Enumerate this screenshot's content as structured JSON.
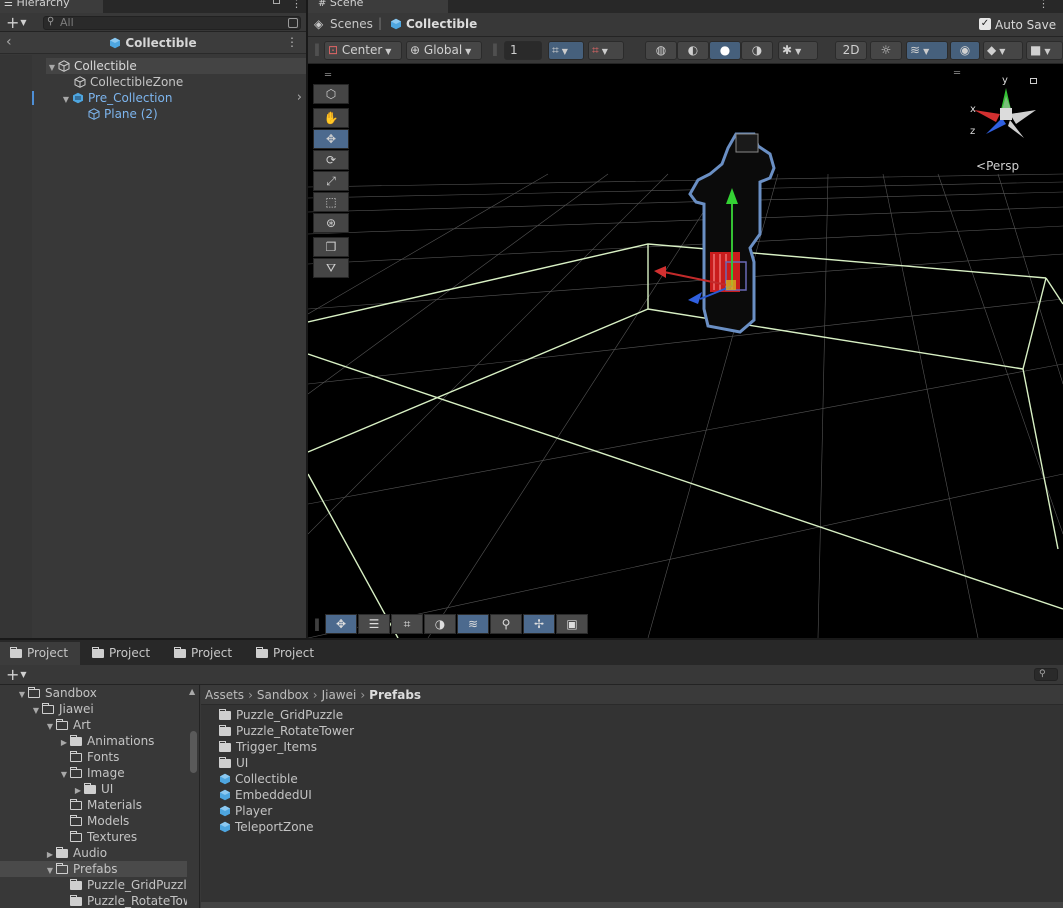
{
  "hierarchy": {
    "tab_title": "Hierarchy",
    "search_placeholder": "All",
    "breadcrumb_title": "Collectible",
    "items": [
      {
        "label": "Collectible"
      },
      {
        "label": "CollectibleZone"
      },
      {
        "label": "Pre_Collection"
      },
      {
        "label": "Plane (2)"
      }
    ]
  },
  "scene": {
    "tab_title": "Scene",
    "breadcrumb_root": "Scenes",
    "breadcrumb_current": "Collectible",
    "auto_save_label": "Auto Save",
    "auto_save_checked": true,
    "pivot_label": "Center",
    "space_label": "Global",
    "grid_value": "1",
    "projection_label": "Persp",
    "gizmo_axes": [
      "y",
      "x",
      "z"
    ]
  },
  "project": {
    "tabs": [
      "Project",
      "Project",
      "Project",
      "Project"
    ],
    "search_placeholder": "",
    "tree": [
      {
        "label": "Sandbox"
      },
      {
        "label": "Jiawei"
      },
      {
        "label": "Art"
      },
      {
        "label": "Animations"
      },
      {
        "label": "Fonts"
      },
      {
        "label": "Image"
      },
      {
        "label": "UI"
      },
      {
        "label": "Materials"
      },
      {
        "label": "Models"
      },
      {
        "label": "Textures"
      },
      {
        "label": "Audio"
      },
      {
        "label": "Prefabs"
      },
      {
        "label": "Puzzle_GridPuzzle"
      },
      {
        "label": "Puzzle_RotateTower"
      }
    ],
    "path": [
      "Assets",
      "Sandbox",
      "Jiawei",
      "Prefabs"
    ],
    "files": [
      {
        "label": "Puzzle_GridPuzzle",
        "type": "folder"
      },
      {
        "label": "Puzzle_RotateTower",
        "type": "folder"
      },
      {
        "label": "Trigger_Items",
        "type": "folder"
      },
      {
        "label": "UI",
        "type": "folder"
      },
      {
        "label": "Collectible",
        "type": "prefab"
      },
      {
        "label": "EmbeddedUI",
        "type": "prefab"
      },
      {
        "label": "Player",
        "type": "prefab"
      },
      {
        "label": "TeleportZone",
        "type": "prefab"
      }
    ]
  },
  "colors": {
    "selection_blue": "#7db5ee",
    "prefab_blue": "#4ea6e0",
    "grid_outline": "#cfe8c0",
    "active_tool": "#4c6a8e"
  }
}
